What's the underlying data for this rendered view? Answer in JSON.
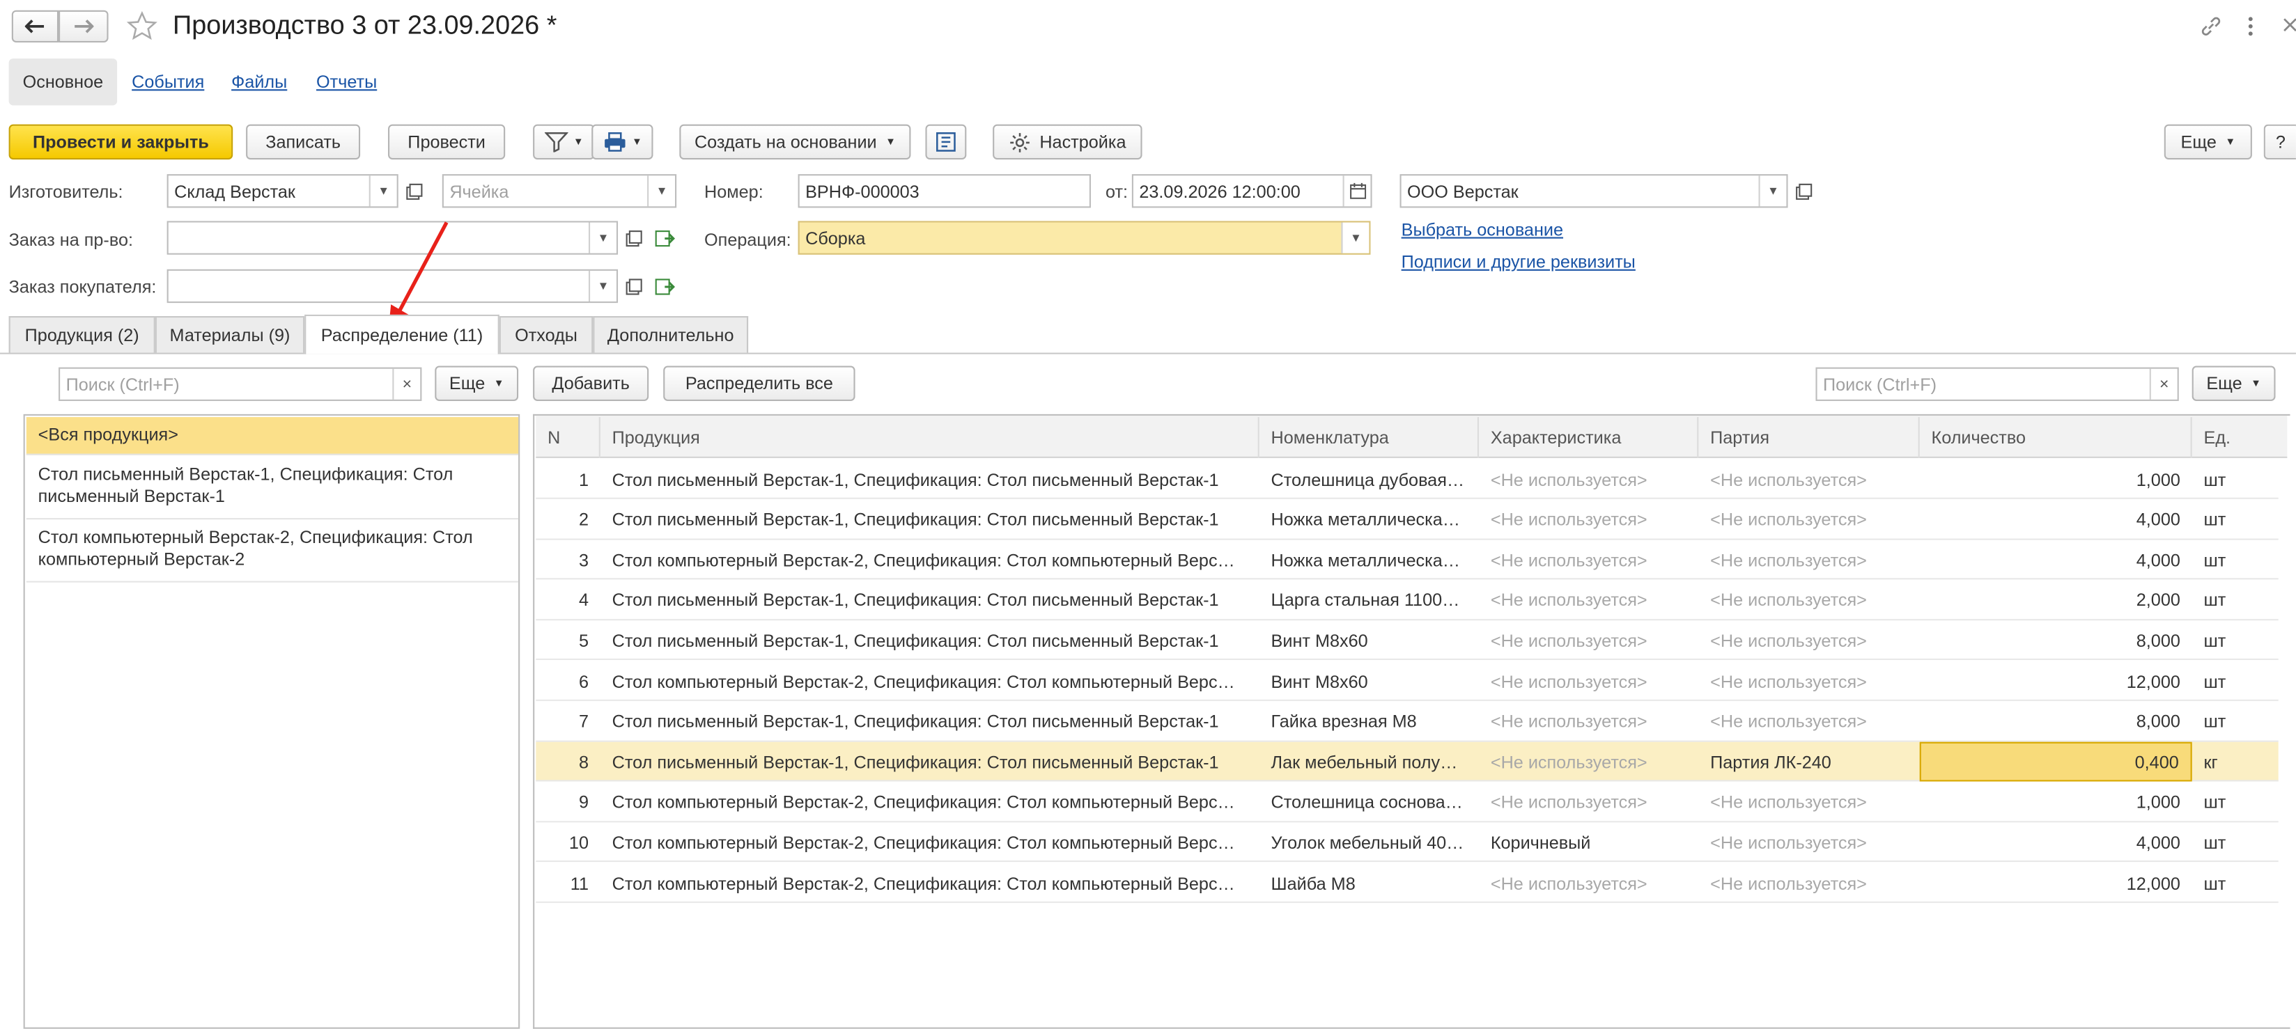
{
  "window": {
    "title": "Производство 3 от 23.09.2026 *"
  },
  "nav_tabs": [
    "Основное",
    "События",
    "Файлы",
    "Отчеты"
  ],
  "toolbar": {
    "post_close": "Провести и закрыть",
    "save": "Записать",
    "post": "Провести",
    "create_based": "Создать на основании",
    "settings": "Настройка",
    "more": "Еще",
    "help": "?"
  },
  "form": {
    "manufacturer_label": "Изготовитель:",
    "manufacturer_value": "Склад Верстак",
    "cell_placeholder": "Ячейка",
    "number_label": "Номер:",
    "number_value": "ВРНФ-000003",
    "date_label": "от:",
    "date_value": "23.09.2026 12:00:00",
    "org_value": "ООО Верстак",
    "prod_order_label": "Заказ на пр-во:",
    "prod_order_value": "",
    "operation_label": "Операция:",
    "operation_value": "Сборка",
    "customer_order_label": "Заказ покупателя:",
    "customer_order_value": "",
    "choose_basis_link": "Выбрать основание",
    "signatures_link": "Подписи и другие реквизиты"
  },
  "tabs": [
    "Продукция (2)",
    "Материалы (9)",
    "Распределение (11)",
    "Отходы",
    "Дополнительно"
  ],
  "left_panel": {
    "search_placeholder": "Поиск (Ctrl+F)",
    "more": "Еще",
    "items": [
      "<Вся продукция>",
      "Стол письменный Верстак-1, Спецификация: Стол письменный Верстак-1",
      "Стол компьютерный Верстак-2, Спецификация: Стол компьютерный Верстак-2"
    ]
  },
  "right_panel": {
    "add": "Добавить",
    "distribute_all": "Распределить все",
    "search_placeholder": "Поиск (Ctrl+F)",
    "more": "Еще"
  },
  "table": {
    "headers": [
      "N",
      "Продукция",
      "Номенклатура",
      "Характеристика",
      "Партия",
      "Количество",
      "Ед."
    ],
    "rows": [
      [
        "1",
        "Стол письменный Верстак-1, Спецификация: Стол письменный Верстак-1",
        "Столешница дубовая…",
        "<Не используется>",
        "<Не используется>",
        "1,000",
        "шт"
      ],
      [
        "2",
        "Стол письменный Верстак-1, Спецификация: Стол письменный Верстак-1",
        "Ножка металлическа…",
        "<Не используется>",
        "<Не используется>",
        "4,000",
        "шт"
      ],
      [
        "3",
        "Стол компьютерный Верстак-2, Спецификация: Стол компьютерный Верс…",
        "Ножка металлическа…",
        "<Не используется>",
        "<Не используется>",
        "4,000",
        "шт"
      ],
      [
        "4",
        "Стол письменный Верстак-1, Спецификация: Стол письменный Верстак-1",
        "Царга стальная 1100…",
        "<Не используется>",
        "<Не используется>",
        "2,000",
        "шт"
      ],
      [
        "5",
        "Стол письменный Верстак-1, Спецификация: Стол письменный Верстак-1",
        "Винт М8х60",
        "<Не используется>",
        "<Не используется>",
        "8,000",
        "шт"
      ],
      [
        "6",
        "Стол компьютерный Верстак-2, Спецификация: Стол компьютерный Верс…",
        "Винт М8х60",
        "<Не используется>",
        "<Не используется>",
        "12,000",
        "шт"
      ],
      [
        "7",
        "Стол письменный Верстак-1, Спецификация: Стол письменный Верстак-1",
        "Гайка врезная М8",
        "<Не используется>",
        "<Не используется>",
        "8,000",
        "шт"
      ],
      [
        "8",
        "Стол письменный Верстак-1, Спецификация: Стол письменный Верстак-1",
        "Лак мебельный полу…",
        "<Не используется>",
        "Партия ЛК-240",
        "0,400",
        "кг"
      ],
      [
        "9",
        "Стол компьютерный Верстак-2, Спецификация: Стол компьютерный Верс…",
        "Столешница соснова…",
        "<Не используется>",
        "<Не используется>",
        "1,000",
        "шт"
      ],
      [
        "10",
        "Стол компьютерный Верстак-2, Спецификация: Стол компьютерный Верс…",
        "Уголок мебельный 40…",
        "Коричневый",
        "<Не используется>",
        "4,000",
        "шт"
      ],
      [
        "11",
        "Стол компьютерный Верстак-2, Спецификация: Стол компьютерный Верс…",
        "Шайба М8",
        "<Не используется>",
        "<Не используется>",
        "12,000",
        "шт"
      ]
    ]
  }
}
